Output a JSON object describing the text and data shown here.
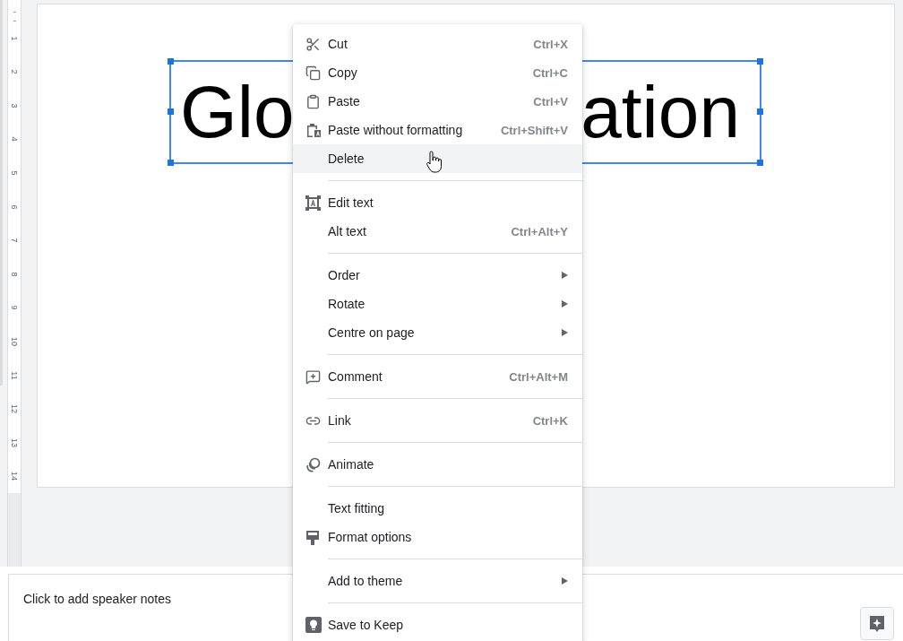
{
  "ruler": {
    "marks": [
      "1",
      "2",
      "3",
      "4",
      "5",
      "6",
      "7",
      "8",
      "9",
      "10",
      "11",
      "12",
      "13",
      "14"
    ]
  },
  "slide": {
    "title_box": {
      "selected": true,
      "visible_text": [
        "Glo",
        "ation"
      ]
    }
  },
  "context_menu": {
    "items": [
      {
        "kind": "item",
        "label": "Cut",
        "shortcut": "Ctrl+X",
        "submenu": false,
        "hovered": false
      },
      {
        "kind": "item",
        "label": "Copy",
        "shortcut": "Ctrl+C",
        "submenu": false,
        "hovered": false
      },
      {
        "kind": "item",
        "label": "Paste",
        "shortcut": "Ctrl+V",
        "submenu": false,
        "hovered": false
      },
      {
        "kind": "item",
        "label": "Paste without formatting",
        "shortcut": "Ctrl+Shift+V",
        "submenu": false,
        "hovered": false
      },
      {
        "kind": "item",
        "label": "Delete",
        "submenu": false,
        "hovered": true
      },
      {
        "kind": "separator"
      },
      {
        "kind": "item",
        "label": "Edit text",
        "submenu": false,
        "hovered": false
      },
      {
        "kind": "item",
        "label": "Alt text",
        "shortcut": "Ctrl+Alt+Y",
        "submenu": false,
        "hovered": false
      },
      {
        "kind": "separator"
      },
      {
        "kind": "item",
        "label": "Order",
        "submenu": true,
        "hovered": false
      },
      {
        "kind": "item",
        "label": "Rotate",
        "submenu": true,
        "hovered": false
      },
      {
        "kind": "item",
        "label": "Centre on page",
        "submenu": true,
        "hovered": false
      },
      {
        "kind": "separator"
      },
      {
        "kind": "item",
        "label": "Comment",
        "shortcut": "Ctrl+Alt+M",
        "submenu": false,
        "hovered": false
      },
      {
        "kind": "separator"
      },
      {
        "kind": "item",
        "label": "Link",
        "shortcut": "Ctrl+K",
        "submenu": false,
        "hovered": false
      },
      {
        "kind": "separator"
      },
      {
        "kind": "item",
        "label": "Animate",
        "submenu": false,
        "hovered": false
      },
      {
        "kind": "separator"
      },
      {
        "kind": "item",
        "label": "Text fitting",
        "submenu": false,
        "hovered": false
      },
      {
        "kind": "item",
        "label": "Format options",
        "submenu": false,
        "hovered": false
      },
      {
        "kind": "separator"
      },
      {
        "kind": "item",
        "label": "Add to theme",
        "submenu": true,
        "hovered": false
      },
      {
        "kind": "separator"
      },
      {
        "kind": "item",
        "label": "Save to Keep",
        "submenu": false,
        "hovered": false
      }
    ]
  },
  "speaker_notes": {
    "prompt": "Click to add speaker notes"
  }
}
